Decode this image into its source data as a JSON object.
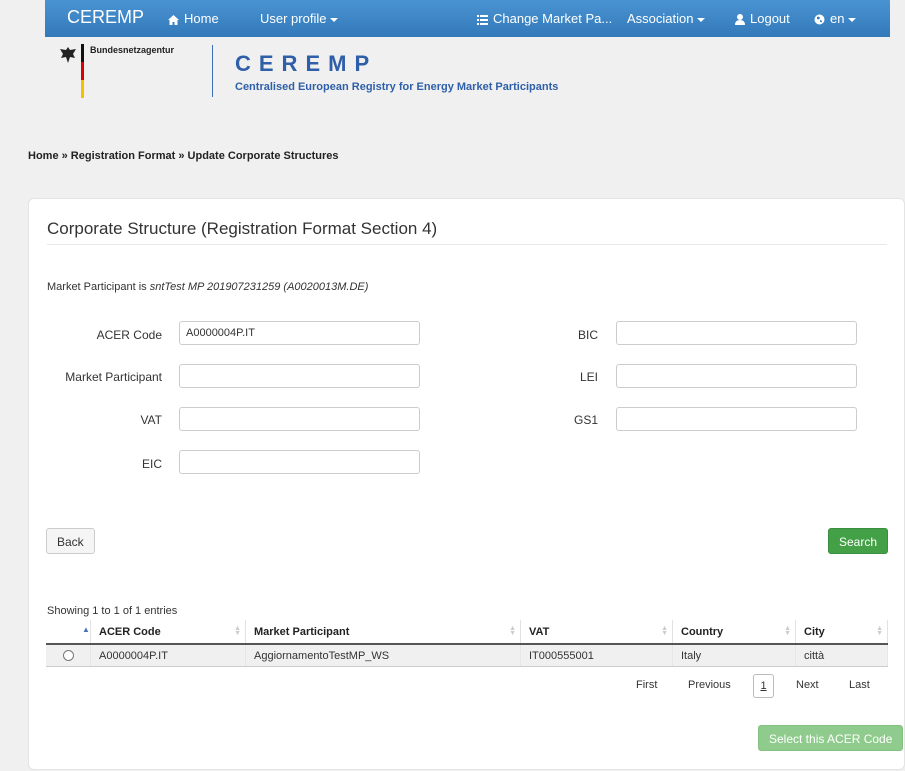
{
  "navbar": {
    "brand": "CEREMP",
    "home": "Home",
    "user_profile": "User profile",
    "change_market": "Change Market Pa...",
    "association": "Association",
    "logout": "Logout",
    "language": "en"
  },
  "header": {
    "bundes_label": "Bundesnetzagentur",
    "ceremp_title": "CEREMP",
    "ceremp_subtitle": "Centralised European Registry for Energy Market Participants"
  },
  "breadcrumb": "Home » Registration Format » Update Corporate Structures",
  "panel": {
    "title": "Corporate Structure (Registration Format Section 4)",
    "mp_prefix": "Market Participant is ",
    "mp_value": "sntTest MP 201907231259 (A0020013M.DE)"
  },
  "form": {
    "acer_label": "ACER Code",
    "acer_value": "A0000004P.IT",
    "mp_label": "Market Participant",
    "mp_value": "",
    "vat_label": "VAT",
    "vat_value": "",
    "eic_label": "EIC",
    "eic_value": "",
    "bic_label": "BIC",
    "bic_value": "",
    "lei_label": "LEI",
    "lei_value": "",
    "gs1_label": "GS1",
    "gs1_value": ""
  },
  "buttons": {
    "back": "Back",
    "search": "Search",
    "select": "Select this ACER Code"
  },
  "table": {
    "showing": "Showing 1 to 1 of 1 entries",
    "columns": [
      "ACER Code",
      "Market Participant",
      "VAT",
      "Country",
      "City"
    ],
    "rows": [
      [
        "A0000004P.IT",
        "AggiornamentoTestMP_WS",
        "IT000555001",
        "Italy",
        "città"
      ]
    ]
  },
  "pagination": {
    "first": "First",
    "previous": "Previous",
    "current": "1",
    "next": "Next",
    "last": "Last"
  },
  "colors": {
    "navbar": "#3379ba",
    "accent_green": "#43a047",
    "brand_blue": "#2e5fa8"
  }
}
